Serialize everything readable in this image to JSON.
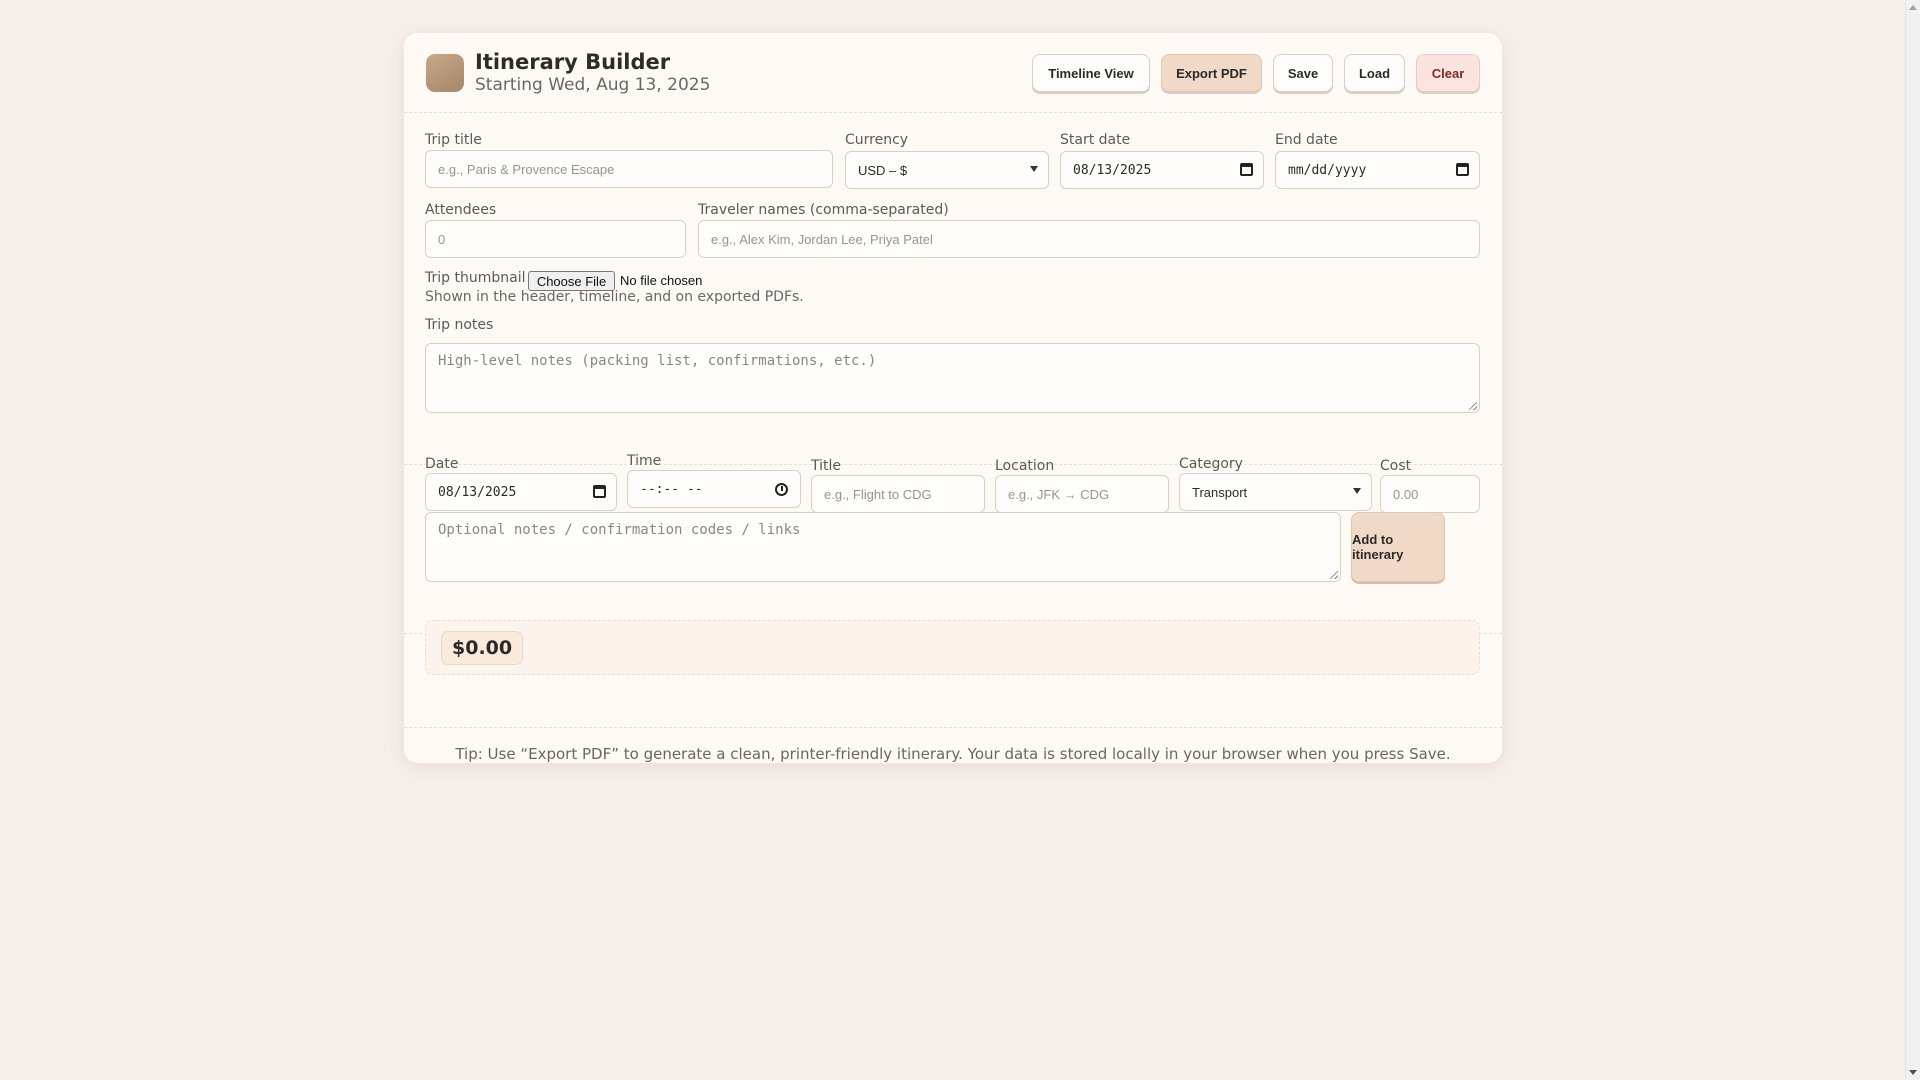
{
  "header": {
    "title": "Itinerary Builder",
    "subtitle": "Starting Wed, Aug 13, 2025",
    "buttons": {
      "timeline": "Timeline View",
      "export": "Export PDF",
      "save": "Save",
      "load": "Load",
      "clear": "Clear"
    }
  },
  "trip": {
    "title_label": "Trip title",
    "title_placeholder": "e.g., Paris & Provence Escape",
    "currency_label": "Currency",
    "currency_value": "USD – $",
    "start_label": "Start date",
    "start_value": "08/13/2025",
    "end_label": "End date",
    "end_value": "mm/dd/yyyy",
    "attendees_label": "Attendees",
    "attendees_placeholder": "0",
    "travelers_label": "Traveler names (comma-separated)",
    "travelers_placeholder": "e.g., Alex Kim, Jordan Lee, Priya Patel",
    "thumbnail_label": "Trip thumbnail",
    "file_button": "Choose File",
    "file_status": "No file chosen",
    "thumbnail_help": "Shown in the header, timeline, and on exported PDFs.",
    "notes_label": "Trip notes",
    "notes_placeholder": "High-level notes (packing list, confirmations, etc.)"
  },
  "entry": {
    "date_label": "Date",
    "date_value": "08/13/2025",
    "time_label": "Time",
    "time_value": "--:-- --",
    "title_label": "Title",
    "title_placeholder": "e.g., Flight to CDG",
    "location_label": "Location",
    "location_placeholder": "e.g., JFK → CDG",
    "category_label": "Category",
    "category_value": "Transport",
    "cost_label": "Cost",
    "cost_placeholder": "0.00",
    "notes_placeholder": "Optional notes / confirmation codes / links",
    "add_button": "Add to itinerary"
  },
  "summary": {
    "total": "$0.00"
  },
  "footer": {
    "tip": "Tip: Use “Export PDF” to generate a clean, printer-friendly itinerary. Your data is stored locally in your browser when you press Save."
  }
}
